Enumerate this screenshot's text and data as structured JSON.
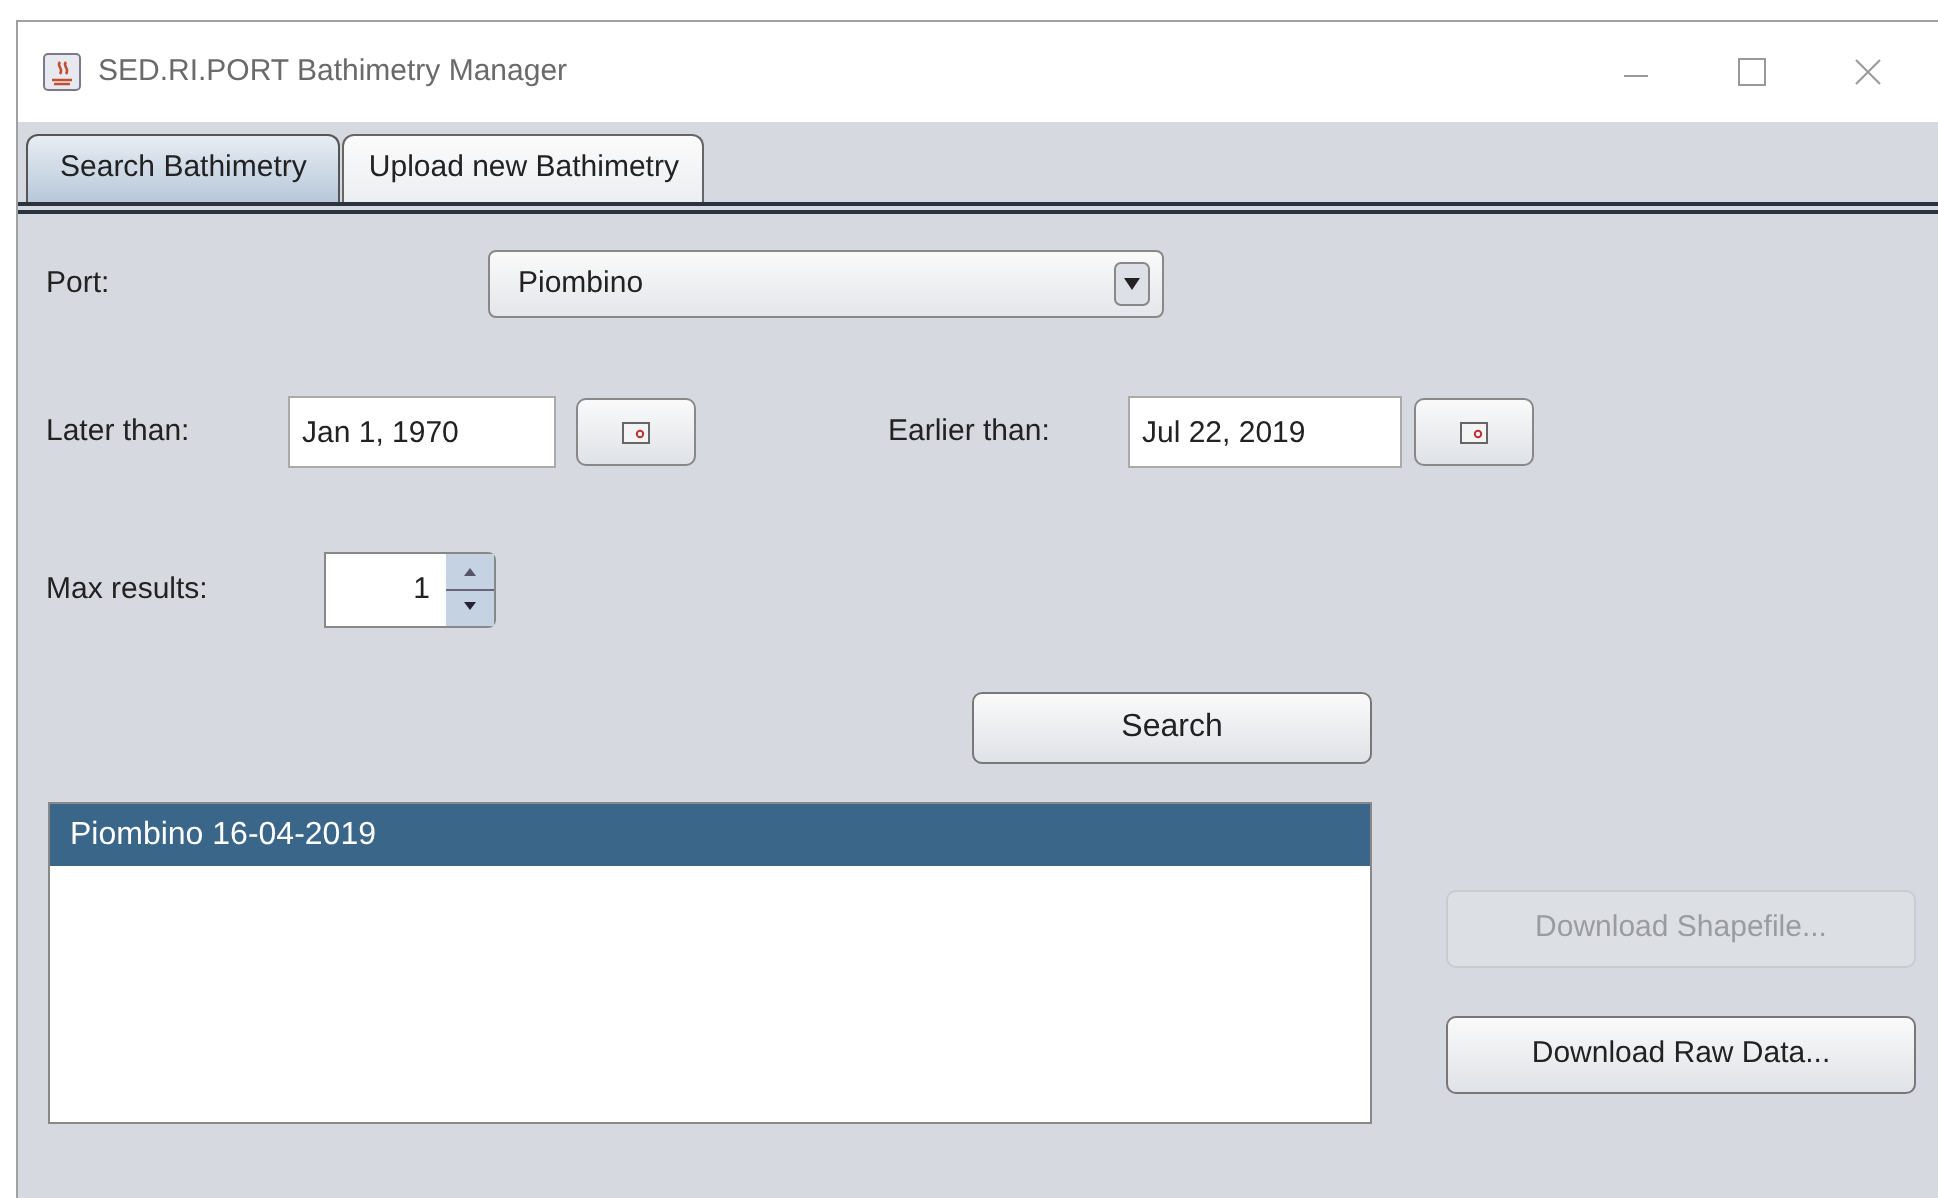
{
  "window": {
    "title": "SED.RI.PORT Bathimetry Manager"
  },
  "tabs": [
    {
      "label": "Search Bathimetry",
      "selected": true
    },
    {
      "label": "Upload new Bathimetry",
      "selected": false
    }
  ],
  "port": {
    "label": "Port:",
    "value": "Piombino"
  },
  "later_than": {
    "label": "Later than:",
    "value": "Jan 1, 1970"
  },
  "earlier_than": {
    "label": "Earlier than:",
    "value": "Jul 22, 2019"
  },
  "max_results": {
    "label": "Max results:",
    "value": "1"
  },
  "search_button": "Search",
  "results": [
    {
      "text": "Piombino 16-04-2019",
      "selected": true
    }
  ],
  "actions": [
    {
      "label": "Download Shapefile...",
      "disabled": true
    },
    {
      "label": "Download Raw Data...",
      "disabled": false
    }
  ]
}
